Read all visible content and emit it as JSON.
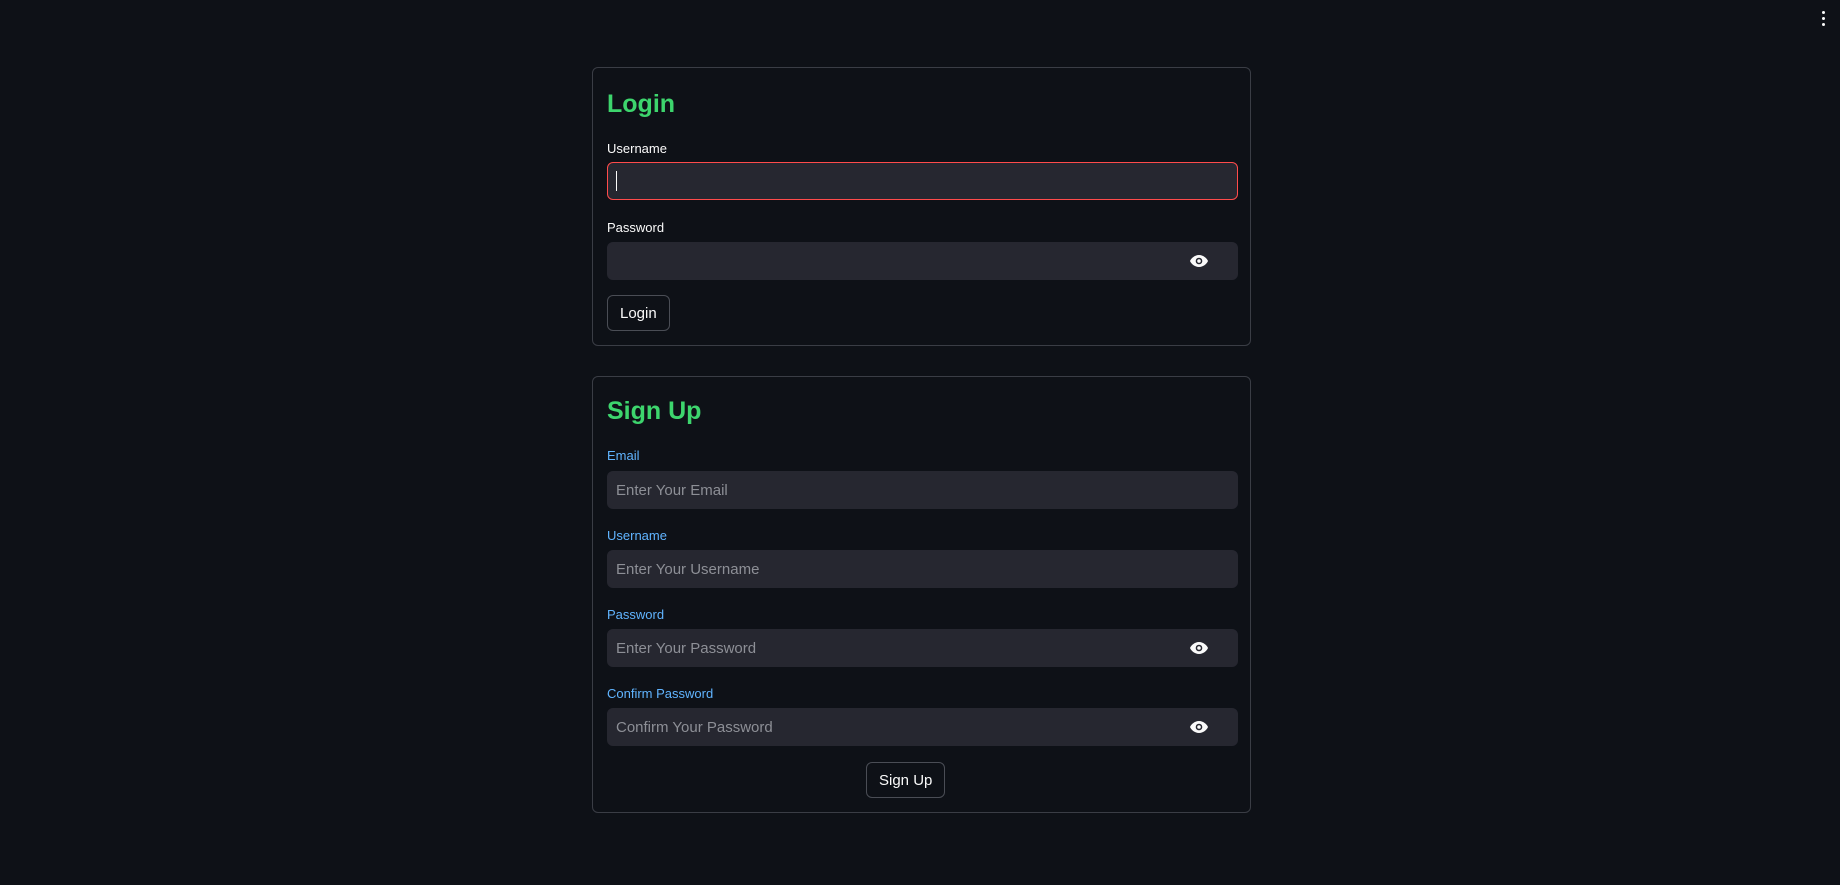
{
  "login": {
    "title": "Login",
    "username_label": "Username",
    "username_value": "",
    "password_label": "Password",
    "password_value": "",
    "button_label": "Login"
  },
  "signup": {
    "title": "Sign Up",
    "email_label": "Email",
    "email_placeholder": "Enter Your Email",
    "username_label": "Username",
    "username_placeholder": "Enter Your Username",
    "password_label": "Password",
    "password_placeholder": "Enter Your Password",
    "confirm_label": "Confirm Password",
    "confirm_placeholder": "Confirm Your Password",
    "button_label": "Sign Up"
  },
  "icons": {
    "menu": "vertical-dots-icon",
    "password_toggle": "eye-icon"
  },
  "colors": {
    "background": "#0e1117",
    "title": "#3dd56d",
    "signup_labels": "#60b4ff",
    "focus_border": "#ff4b4b",
    "input_bg": "#262730"
  }
}
